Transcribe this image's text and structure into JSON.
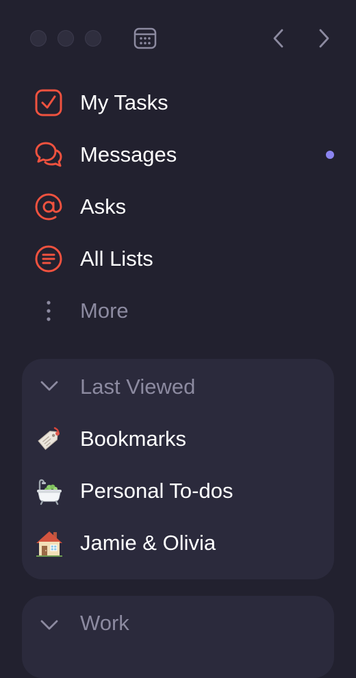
{
  "titlebar": {
    "window_controls": [
      "close",
      "minimize",
      "zoom"
    ],
    "calendar_icon": "calendar-icon",
    "back_icon": "chevron-left-icon",
    "forward_icon": "chevron-right-icon"
  },
  "nav": {
    "items": [
      {
        "label": "My Tasks",
        "icon": "check-square-icon"
      },
      {
        "label": "Messages",
        "icon": "chat-bubbles-icon",
        "unread": true
      },
      {
        "label": "Asks",
        "icon": "at-sign-icon"
      },
      {
        "label": "All Lists",
        "icon": "list-circle-icon"
      },
      {
        "label": "More",
        "icon": "more-vertical-icon"
      }
    ]
  },
  "last_viewed": {
    "title": "Last Viewed",
    "items": [
      {
        "label": "Bookmarks",
        "icon": "bookmark-tag-emoji"
      },
      {
        "label": "Personal To-dos",
        "icon": "bathtub-emoji"
      },
      {
        "label": "Jamie & Olivia",
        "icon": "house-emoji"
      }
    ]
  },
  "work": {
    "title": "Work"
  },
  "colors": {
    "background": "#22212f",
    "panel": "#2b2a3c",
    "accent": "#f0523f",
    "muted_text": "#8c8aa0",
    "unread_dot": "#8b84f0"
  }
}
